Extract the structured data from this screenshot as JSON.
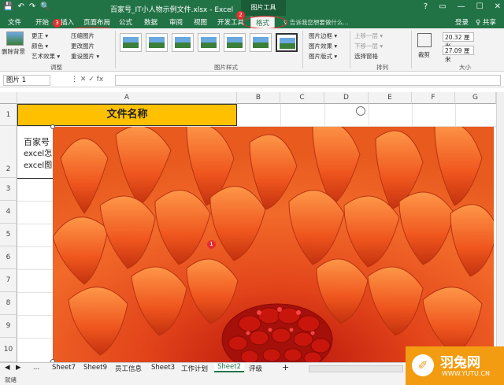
{
  "window": {
    "title": "百家号_IT小人物示例文件.xlsx - Excel",
    "context_tab_group": "图片工具",
    "qat": [
      "💾",
      "↶",
      "↷",
      "🔍"
    ],
    "window_buttons": [
      "?",
      "▭",
      "—",
      "☐",
      "✕"
    ]
  },
  "ribbon_tabs": {
    "file": "文件",
    "home": "开始",
    "insert": "插入",
    "layout": "页面布局",
    "formulas": "公式",
    "data": "数据",
    "review": "审阅",
    "view": "视图",
    "developer": "开发工具",
    "format": "格式",
    "tell_me": "♀ 告诉我您想要做什么...",
    "login": "登录",
    "share": "♀ 共享"
  },
  "ribbon": {
    "remove_bg": "删除背景",
    "corrections": "更正 ▾",
    "color": "颜色 ▾",
    "artistic": "艺术效果 ▾",
    "compress": "压缩图片",
    "change": "更改图片",
    "reset": "重设图片 ▾",
    "adjust_label": "调整",
    "styles_label": "图片样式",
    "border": "图片边框 ▾",
    "effects": "图片效果 ▾",
    "layout": "图片版式 ▾",
    "bring_forward": "上移一层 ▾",
    "send_backward": "下移一层 ▾",
    "selection_pane": "选择窗格",
    "arrange_label": "排列",
    "crop": "裁剪",
    "height": "20.32 厘米",
    "width": "27.09 厘米",
    "size_label": "大小"
  },
  "annotations": {
    "n1": "1",
    "n2": "2",
    "n3": "3"
  },
  "formula_bar": {
    "name_box": "图片 1",
    "icons": "⋮  ✕  ✓  fx",
    "value": ""
  },
  "columns": [
    "A",
    "B",
    "C",
    "D",
    "E",
    "F",
    "G"
  ],
  "rows": [
    "1",
    "2",
    "3",
    "4",
    "5",
    "6",
    "7",
    "8",
    "9",
    "10"
  ],
  "cells": {
    "a1": "文件名称",
    "a2_line1": "百家号",
    "a2_line2": "excel怎",
    "a2_line3": "excel图"
  },
  "sheet_tabs": {
    "prev": "◀",
    "next": "▶",
    "more": "...",
    "sheets": [
      "Sheet7",
      "Sheet9",
      "员工信息",
      "Sheet3",
      "工作计划",
      "Sheet2",
      "评级"
    ],
    "active": "Sheet2",
    "add": "+"
  },
  "status": {
    "ready": "就绪",
    "zoom": "100%"
  },
  "watermark": {
    "brand": "羽兔网",
    "url": "WWW.YUTU.CN"
  }
}
